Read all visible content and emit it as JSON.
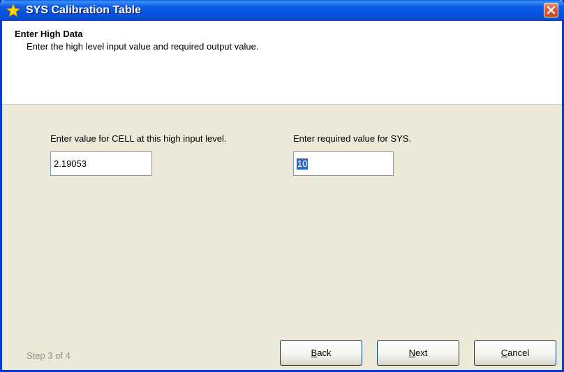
{
  "window": {
    "title": "SYS Calibration Table",
    "title_icon": "star-icon",
    "close_icon": "close-icon"
  },
  "header": {
    "title": "Enter High Data",
    "subtitle": "Enter the high level input value and required output value."
  },
  "form": {
    "cell_label": "Enter value for CELL at this high input level.",
    "cell_value": "2.19053",
    "sys_label": "Enter required value for SYS.",
    "sys_value": "10"
  },
  "footer": {
    "step_text": "Step 3 of 4",
    "back": {
      "accel": "B",
      "rest": "ack"
    },
    "next": {
      "accel": "N",
      "rest": "ext"
    },
    "cancel": {
      "accel": "C",
      "rest": "ancel"
    }
  },
  "colors": {
    "titlebar": "#0553dd",
    "close_button": "#e25a33",
    "dialog_background": "#ece9d8",
    "selection": "#316ac5"
  }
}
